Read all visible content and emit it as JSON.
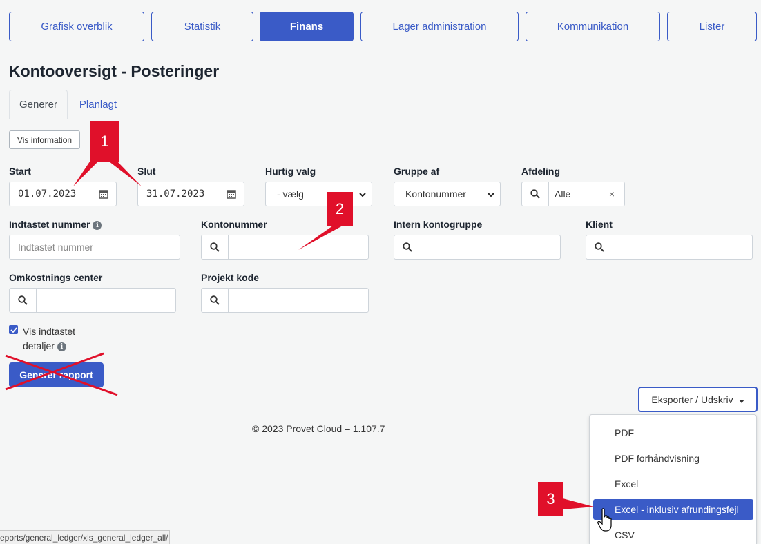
{
  "nav": {
    "items": [
      {
        "label": "Grafisk overblik",
        "active": false
      },
      {
        "label": "Statistik",
        "active": false
      },
      {
        "label": "Finans",
        "active": true
      },
      {
        "label": "Lager administration",
        "active": false
      },
      {
        "label": "Kommunikation",
        "active": false
      },
      {
        "label": "Lister",
        "active": false
      }
    ]
  },
  "page": {
    "title": "Kontooversigt - Posteringer"
  },
  "tabs": {
    "generate": "Generer",
    "planned": "Planlagt"
  },
  "info_button": "Vis information",
  "form": {
    "start": {
      "label": "Start",
      "value": "01.07.2023"
    },
    "end": {
      "label": "Slut",
      "value": "31.07.2023"
    },
    "quick": {
      "label": "Hurtig valg",
      "value": "- vælg"
    },
    "group": {
      "label": "Gruppe af",
      "value": "Kontonummer"
    },
    "department": {
      "label": "Afdeling",
      "value": "Alle",
      "clear": "×"
    },
    "entered_number": {
      "label": "Indtastet nummer",
      "placeholder": "Indtastet nummer"
    },
    "account_number": {
      "label": "Kontonummer"
    },
    "internal_group": {
      "label": "Intern kontogruppe"
    },
    "client": {
      "label": "Klient"
    },
    "cost_center": {
      "label": "Omkostnings center"
    },
    "project_code": {
      "label": "Projekt kode"
    },
    "show_details": {
      "label": "Vis indtastet detaljer",
      "checked": true
    }
  },
  "generate_button": "Generer rapport",
  "export": {
    "label": "Eksporter / Udskriv",
    "items": [
      "PDF",
      "PDF forhåndvisning",
      "Excel",
      "Excel - inklusiv afrundingsfejl",
      "CSV"
    ],
    "selected_index": 3
  },
  "footer": "© 2023 Provet Cloud – 1.107.7",
  "status_url": "eports/general_ledger/xls_general_ledger_all/",
  "annotations": [
    "1",
    "2",
    "3"
  ],
  "colors": {
    "primary": "#3a5bc7",
    "annotation": "#e0102a",
    "background": "#f5f6f6"
  }
}
